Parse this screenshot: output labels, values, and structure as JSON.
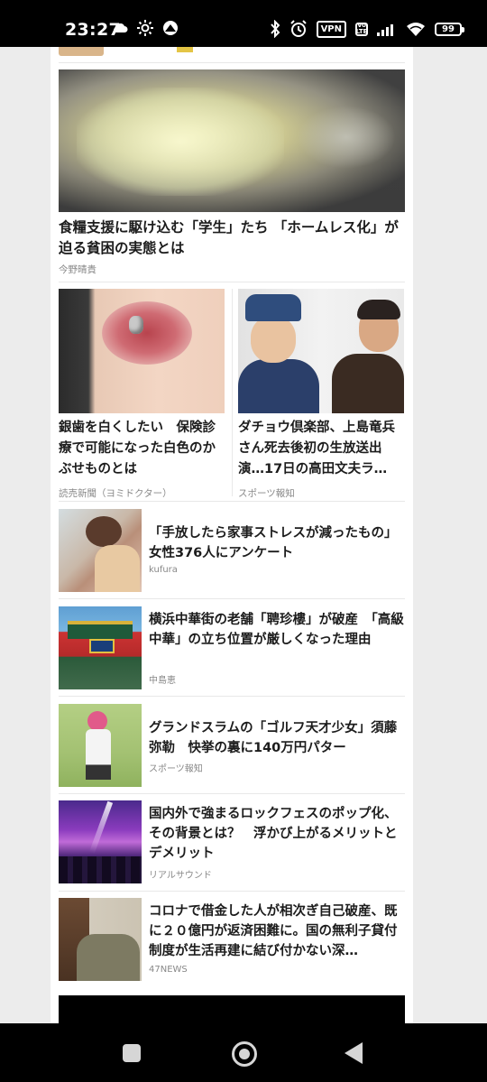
{
  "status_bar": {
    "time": "23:27",
    "left_icons": [
      "cloud-icon",
      "sun-icon",
      "app-icon"
    ],
    "right_icons": [
      "bluetooth-icon",
      "alarm-icon",
      "vpn-icon",
      "volte-icon",
      "signal-icon",
      "wifi-icon",
      "battery-icon"
    ],
    "vpn_label": "VPN",
    "volte_top": "Vo",
    "volte_bottom": "LTE",
    "battery_level": "99"
  },
  "hero": {
    "title": "食糧支援に駆け込む「学生」たち 「ホームレス化」が迫る貧困の実態とは",
    "source": "今野晴貴"
  },
  "cards": [
    {
      "title": "銀歯を白くしたい　保険診療で可能になった白色のかぶせものとは",
      "source": "読売新聞（ヨミドクター）"
    },
    {
      "title": "ダチョウ倶楽部、上島竜兵さん死去後初の生放送出演…17日の高田文夫ラ…",
      "source": "スポーツ報知"
    }
  ],
  "list_items": [
    {
      "title": "「手放したら家事ストレスが減ったもの」女性376人にアンケート",
      "source": "kufura"
    },
    {
      "title": "横浜中華街の老舗「聘珍樓」が破産　「高級中華」の立ち位置が厳しくなった理由",
      "source": "中島恵"
    },
    {
      "title": "グランドスラムの「ゴルフ天才少女」須藤弥勒　快挙の裏に140万円パター",
      "source": "スポーツ報知"
    },
    {
      "title": "国内外で強まるロックフェスのポップ化、その背景とは？　浮かび上がるメリットとデメリット",
      "source": "リアルサウンド"
    },
    {
      "title": "コロナで借金した人が相次ぎ自己破産、既に２０億円が返済困難に。国の無利子貸付制度が生活再建に結び付かない深…",
      "source": "47NEWS"
    }
  ],
  "nav_bar": {
    "buttons": [
      "recent-apps-button",
      "home-button",
      "back-button"
    ]
  }
}
